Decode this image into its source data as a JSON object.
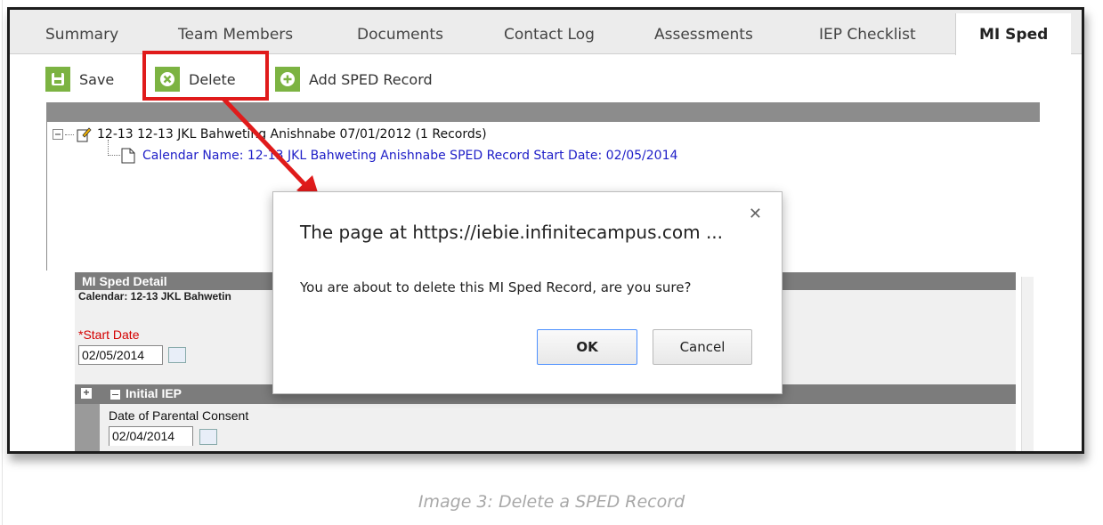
{
  "tabs": [
    {
      "label": "Summary"
    },
    {
      "label": "Team Members"
    },
    {
      "label": "Documents"
    },
    {
      "label": "Contact Log"
    },
    {
      "label": "Assessments"
    },
    {
      "label": "IEP Checklist"
    },
    {
      "label": "MI Sped",
      "active": true
    }
  ],
  "toolbar": {
    "save_label": "Save",
    "delete_label": "Delete",
    "add_label": "Add SPED Record"
  },
  "tree": {
    "parent": "12-13 12-13 JKL Bahweting Anishnabe 07/01/2012 (1 Records)",
    "child": "Calendar Name: 12-13 JKL Bahweting Anishnabe SPED Record Start Date: 02/05/2014"
  },
  "detail": {
    "title": "MI Sped Detail",
    "calendar": "Calendar: 12-13 JKL Bahwetin",
    "start_date_label": "*Start Date",
    "start_date_value": "02/05/2014",
    "section_title": "Initial IEP",
    "consent_label": "Date of Parental Consent",
    "consent_value": "02/04/2014"
  },
  "dialog": {
    "title": "The page at https://iebie.infinitecampus.com ...",
    "message": "You are about to delete this MI Sped Record, are you sure?",
    "ok_label": "OK",
    "cancel_label": "Cancel"
  },
  "caption": "Image 3: Delete a SPED Record",
  "colors": {
    "accent_green": "#7cb342",
    "highlight_red": "#e01b1b",
    "link_blue": "#2020c8",
    "header_gray": "#7c7c7c"
  }
}
